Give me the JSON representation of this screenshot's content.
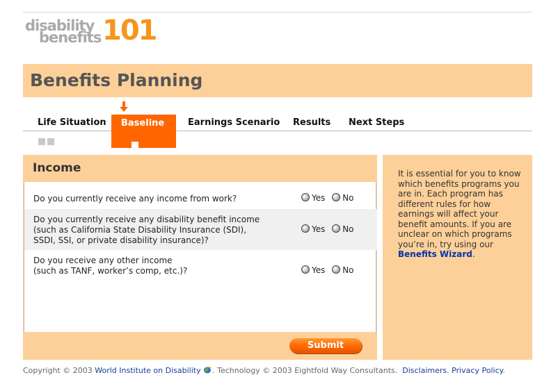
{
  "logo": {
    "word1": "disability",
    "word2": "benefits",
    "number": "101"
  },
  "page_title": "Benefits Planning",
  "tabs": [
    {
      "label": "Life Situation"
    },
    {
      "label": "Baseline"
    },
    {
      "label": "Earnings Scenario"
    },
    {
      "label": "Results"
    },
    {
      "label": "Next Steps"
    }
  ],
  "income": {
    "heading": "Income",
    "questions": [
      {
        "text_line1": "Do you currently receive any income from work?",
        "text_line2": "",
        "text_line3": "",
        "yes": "Yes",
        "no": "No"
      },
      {
        "text_line1": "Do you currently receive any disability benefit income",
        "text_line2": "(such as California State Disability Insurance (SDI),",
        "text_line3": "SSDI, SSI, or private disability insurance)?",
        "yes": "Yes",
        "no": "No"
      },
      {
        "text_line1": "Do you receive any other income",
        "text_line2": "(such as TANF, worker’s comp, etc.)?",
        "text_line3": "",
        "yes": "Yes",
        "no": "No"
      }
    ],
    "submit_label": "Submit"
  },
  "sidebar": {
    "text": "It is essential for you to know which benefits programs you are in. Each program has different rules for how earnings will affect your benefit amounts. If you are unclear on which programs you’re in, try using our ",
    "link": "Benefits Wizard",
    "end": "."
  },
  "footer": {
    "copyright": "Copyright © 2003 ",
    "wid_link": "World Institute on Disability",
    "tech": ". Technology © 2003 Eightfold Way Consultants.",
    "disclaimers": "Disclaimers",
    "privacy": "Privacy Policy"
  },
  "colors": {
    "accent": "#ff6600",
    "panel": "#fdd099",
    "logo_gray": "#a9a9a9",
    "logo_orange": "#f7941d",
    "link": "#1a3d99"
  }
}
